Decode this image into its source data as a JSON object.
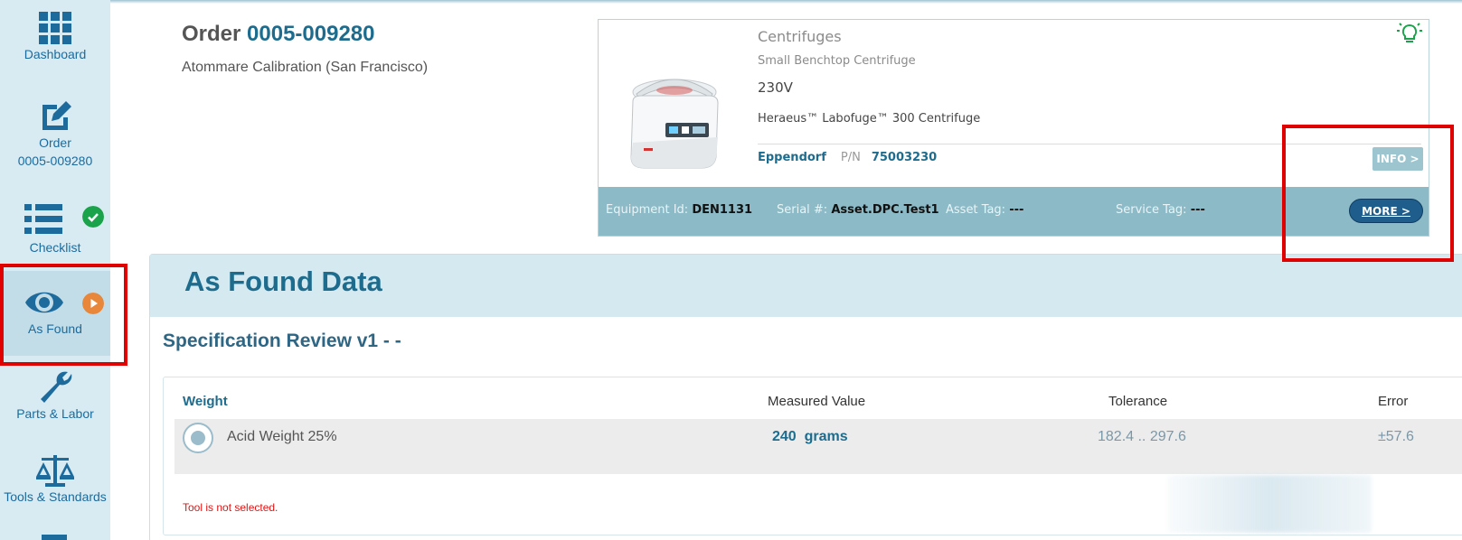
{
  "sidebar": {
    "items": [
      {
        "label": "Dashboard"
      },
      {
        "label": "Order",
        "label2": "0005-009280"
      },
      {
        "label": "Checklist",
        "status": "complete"
      },
      {
        "label": "As Found",
        "status": "in-progress"
      },
      {
        "label": "Parts & Labor"
      },
      {
        "label": "Tools & Standards"
      }
    ],
    "icons": [
      "grid-icon",
      "edit-icon",
      "list-icon",
      "eye-icon",
      "wrench-icon",
      "scale-icon"
    ]
  },
  "order": {
    "prefix": "Order",
    "number": "0005-009280",
    "subtitle": "Atommare Calibration (San Francisco)"
  },
  "equipment": {
    "category": "Centrifuges",
    "subcategory": "Small Benchtop Centrifuge",
    "voltage": "230V",
    "model": "Heraeus™ Labofuge™ 300 Centrifuge",
    "manufacturer": "Eppendorf",
    "pn_label": "P/N",
    "pn_value": "75003230",
    "info_label": "INFO >",
    "equipment_id_label": "Equipment Id:",
    "equipment_id_value": "DEN1131",
    "serial_label": "Serial #:",
    "serial_value": "Asset.DPC.Test1",
    "asset_tag_label": "Asset Tag:",
    "asset_tag_value": "---",
    "service_tag_label": "Service Tag:",
    "service_tag_value": "---",
    "more_label": "MORE >"
  },
  "as_found": {
    "title": "As Found Data",
    "spec_title": "Specification Review v1 - -",
    "columns": {
      "weight": "Weight",
      "measured": "Measured Value",
      "tolerance": "Tolerance",
      "error": "Error"
    },
    "rows": [
      {
        "name": "Acid Weight 25%",
        "measured": "240  grams",
        "tolerance": "182.4 .. 297.6",
        "error": "±57.6"
      }
    ],
    "tool_message": "Tool is not selected."
  },
  "colors": {
    "accent": "#1d6c8e",
    "sidebar_bg": "#d9ebf2",
    "highlight": "#e10000",
    "complete": "#1aa34a",
    "in_progress": "#e8863a"
  }
}
